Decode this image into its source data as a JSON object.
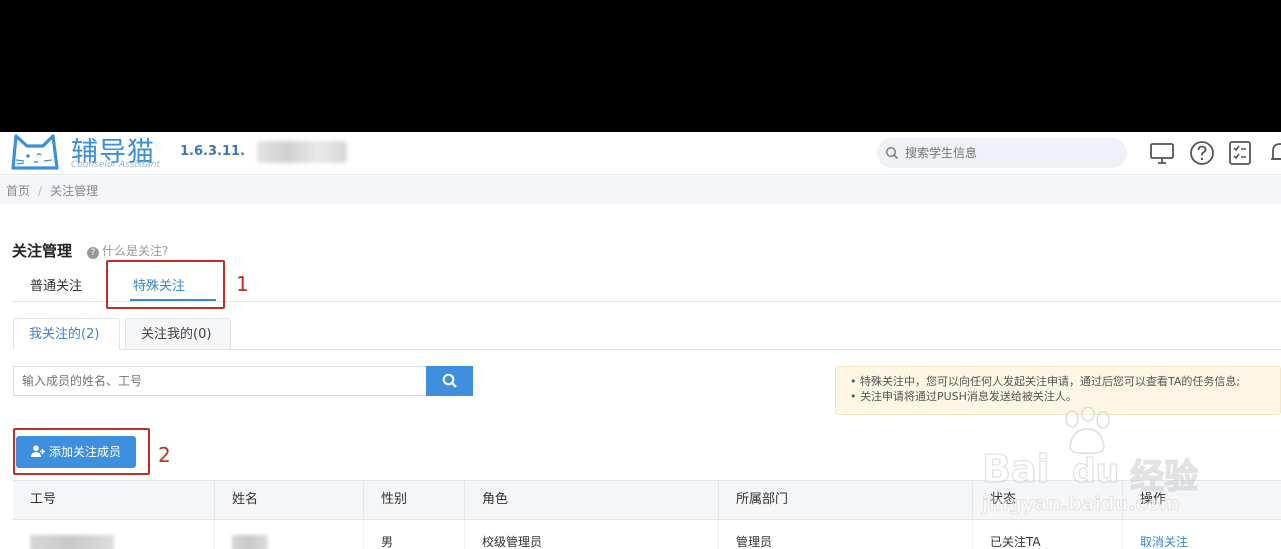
{
  "app": {
    "logo_title": "辅导猫",
    "logo_subtitle": "Counselor Assistant",
    "version": "1.6.3.11."
  },
  "search": {
    "placeholder": "搜索学生信息"
  },
  "breadcrumb": {
    "home": "首页",
    "separator": "/",
    "current": "关注管理"
  },
  "page": {
    "title": "关注管理",
    "help_link": "什么是关注?"
  },
  "main_tabs": [
    {
      "label": "普通关注",
      "active": false
    },
    {
      "label": "特殊关注",
      "active": true
    }
  ],
  "sub_tabs": [
    {
      "label": "我关注的(2)",
      "active": true
    },
    {
      "label": "关注我的(0)",
      "active": false
    }
  ],
  "member_search": {
    "placeholder": "输入成员的姓名、工号"
  },
  "notice": {
    "lines": [
      "• 特殊关注中，您可以向任何人发起关注申请，通过后您可以查看TA的任务信息;",
      "• 关注申请将通过PUSH消息发送给被关注人。"
    ]
  },
  "add_button": {
    "label": "添加关注成员"
  },
  "annotations": {
    "n1": "1",
    "n2": "2"
  },
  "table": {
    "columns": [
      "工号",
      "姓名",
      "性别",
      "角色",
      "所属部门",
      "状态",
      "操作"
    ],
    "rows": [
      {
        "gender": "男",
        "role": "校级管理员",
        "department": "管理员",
        "status": "已关注TA",
        "action": "取消关注"
      }
    ]
  },
  "watermark": {
    "brand": "Bai",
    "brand2": "du",
    "cn": "经验",
    "url": "jingyan.baidu.com"
  },
  "colors": {
    "accent": "#3a86d0",
    "button": "#3f8fe0",
    "annotation": "#c0302a",
    "notice_bg": "#fdf6e5"
  }
}
